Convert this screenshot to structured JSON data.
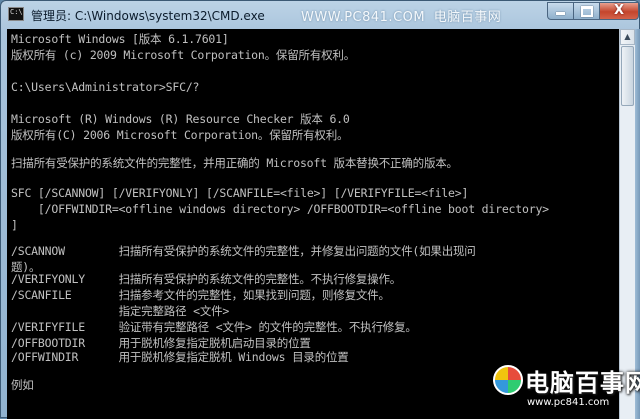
{
  "window": {
    "title": "管理员: C:\\Windows\\system32\\CMD.exe",
    "watermark_url": "WWW.PC841.COM",
    "watermark_site": "电脑百事网",
    "minimize_label": "",
    "maximize_label": "",
    "close_label": "X"
  },
  "console_lines": [
    "Microsoft Windows [版本 6.1.7601]",
    "版权所有 (c) 2009 Microsoft Corporation。保留所有权利。",
    "",
    "C:\\Users\\Administrator>SFC/?",
    "",
    "Microsoft (R) Windows (R) Resource Checker 版本 6.0",
    "版权所有(C) 2006 Microsoft Corporation。保留所有权利。",
    "",
    "扫描所有受保护的系统文件的完整性，并用正确的 Microsoft 版本替换不正确的版本。",
    "",
    "SFC [/SCANNOW] [/VERIFYONLY] [/SCANFILE=<file>] [/VERIFYFILE=<file>]",
    "    [/OFFWINDIR=<offline windows directory> /OFFBOOTDIR=<offline boot directory>",
    "]",
    "",
    "/SCANNOW        扫描所有受保护的系统文件的完整性，并修复出问题的文件(如果出现问",
    "题)。",
    "/VERIFYONLY     扫描所有受保护的系统文件的完整性。不执行修复操作。",
    "/SCANFILE       扫描参考文件的完整性，如果找到问题，则修复文件。",
    "                指定完整路径 <文件>",
    "/VERIFYFILE     验证带有完整路径 <文件> 的文件的完整性。不执行修复。",
    "/OFFBOOTDIR     用于脱机修复指定脱机启动目录的位置",
    "/OFFWINDIR      用于脱机修复指定脱机 Windows 目录的位置",
    "",
    "例如"
  ],
  "watermark_badge": {
    "big_text": "电脑百事网",
    "small_text": "www.pc841.com"
  },
  "icons": {
    "app": "cmd-icon",
    "logo": "pc841-logo-icon"
  }
}
